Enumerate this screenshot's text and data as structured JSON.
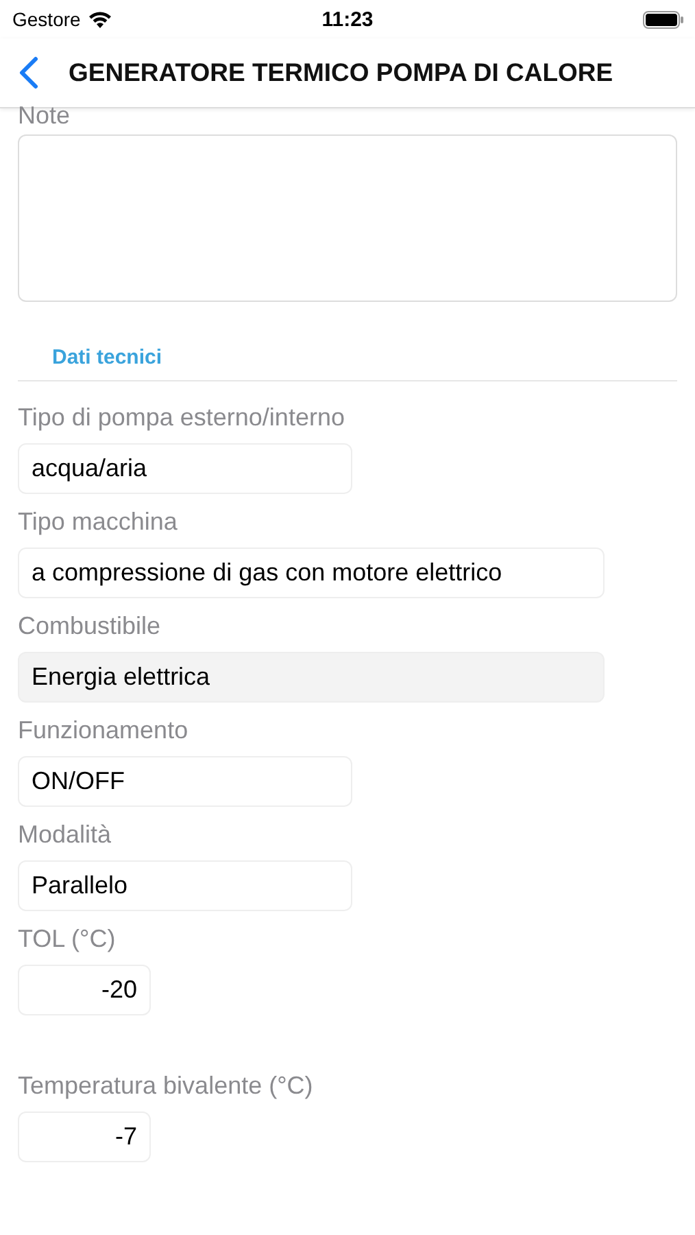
{
  "status_bar": {
    "carrier": "Gestore",
    "time": "11:23"
  },
  "nav": {
    "title": "GENERATORE TERMICO POMPA DI CALORE"
  },
  "note": {
    "label": "Note"
  },
  "section": {
    "title": "Dati tecnici"
  },
  "fields": [
    {
      "label": "Tipo di pompa esterno/interno",
      "value": "acqua/aria",
      "kind": "short",
      "disabled": false
    },
    {
      "label": "Tipo macchina",
      "value": "a compressione di gas con motore elettrico",
      "kind": "long",
      "disabled": false
    },
    {
      "label": "Combustibile",
      "value": "Energia elettrica",
      "kind": "long",
      "disabled": true
    },
    {
      "label": "Funzionamento",
      "value": "ON/OFF",
      "kind": "short",
      "disabled": false
    },
    {
      "label": "Modalità",
      "value": "Parallelo",
      "kind": "short",
      "disabled": false
    },
    {
      "label": "TOL (°C)",
      "value": "-20",
      "kind": "number",
      "disabled": false
    },
    {
      "label": "Temperatura bivalente (°C)",
      "value": "-7",
      "kind": "number",
      "disabled": false
    }
  ]
}
